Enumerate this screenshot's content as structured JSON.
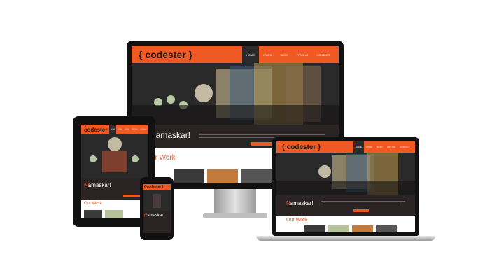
{
  "site": {
    "brand": "{ codester }",
    "nav": [
      "HOME",
      "WORK",
      "BLOG",
      "PRICING",
      "CONTACT"
    ],
    "greeting_initial": "N",
    "greeting_rest": "amaskar!",
    "section_title": "Our Work"
  },
  "colors": {
    "accent": "#ef5a24",
    "dark": "#1d1a1a",
    "device_frame": "#111111",
    "aluminium": "#c9c9c9"
  },
  "devices": [
    "desktop-monitor",
    "tablet",
    "laptop",
    "phone"
  ]
}
